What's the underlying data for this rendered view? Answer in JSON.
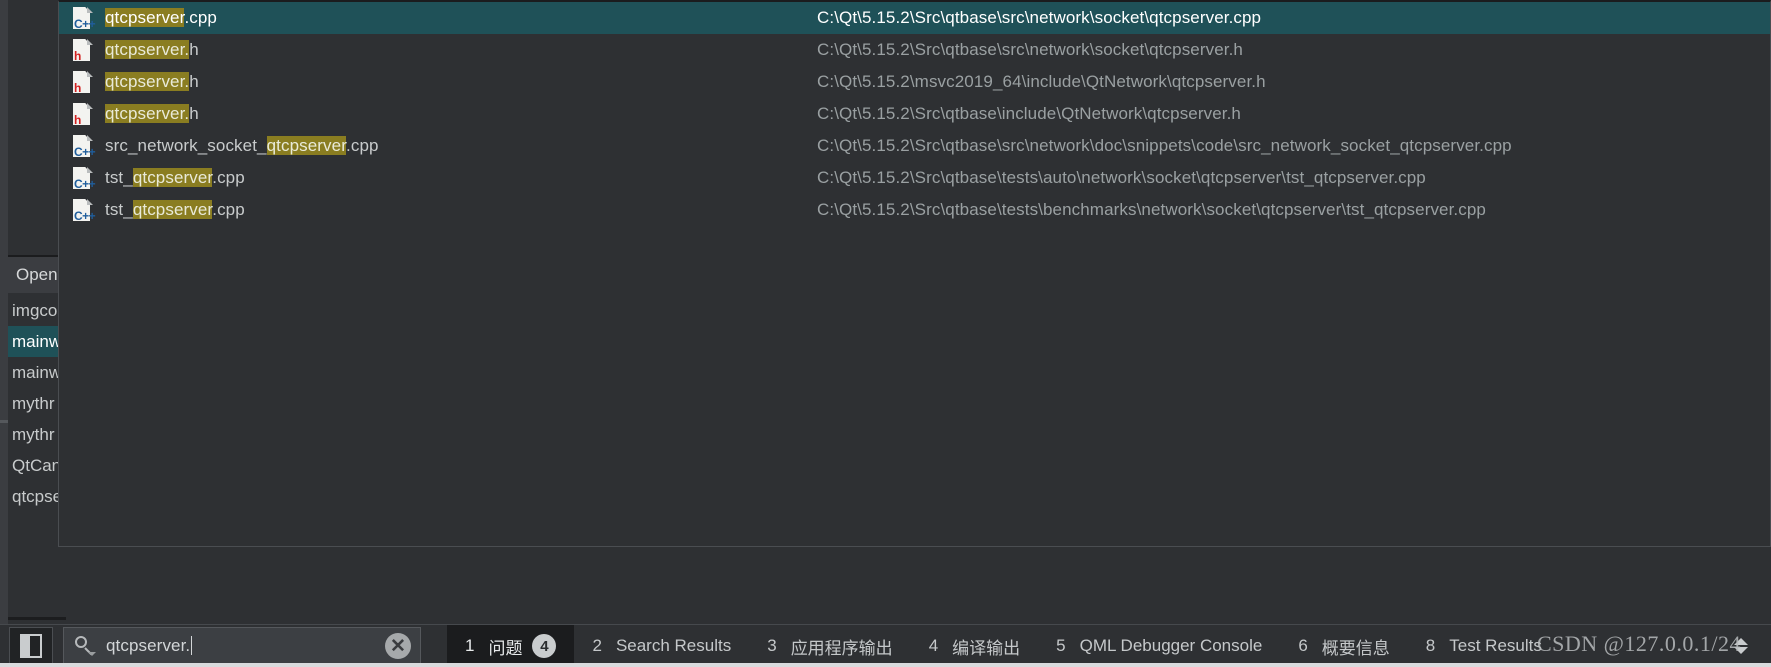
{
  "colors": {
    "background": "#2e3033",
    "selection_teal": "#1f5158",
    "match_highlight": "#8a7d21",
    "text_primary": "#c8cbcc",
    "text_muted": "#9aa0a2",
    "cpp_icon": "#1f5d9c",
    "h_icon": "#d32020"
  },
  "locator_popup": {
    "results": [
      {
        "icon": "cpp-file-icon",
        "icon_tag": "C++",
        "name_pre": "",
        "name_match": "qtcpserver",
        "name_post": ".cpp",
        "path": "C:\\Qt\\5.15.2\\Src\\qtbase\\src\\network\\socket\\qtcpserver.cpp",
        "selected": true
      },
      {
        "icon": "h-file-icon",
        "icon_tag": "h",
        "name_pre": "",
        "name_match": "qtcpserver.",
        "name_post": "h",
        "path": "C:\\Qt\\5.15.2\\Src\\qtbase\\src\\network\\socket\\qtcpserver.h",
        "selected": false
      },
      {
        "icon": "h-file-icon",
        "icon_tag": "h",
        "name_pre": "",
        "name_match": "qtcpserver.",
        "name_post": "h",
        "path": "C:\\Qt\\5.15.2\\msvc2019_64\\include\\QtNetwork\\qtcpserver.h",
        "selected": false
      },
      {
        "icon": "h-file-icon",
        "icon_tag": "h",
        "name_pre": "",
        "name_match": "qtcpserver.",
        "name_post": "h",
        "path": "C:\\Qt\\5.15.2\\Src\\qtbase\\include\\QtNetwork\\qtcpserver.h",
        "selected": false
      },
      {
        "icon": "cpp-file-icon",
        "icon_tag": "C++",
        "name_pre": "src_network_socket_",
        "name_match": "qtcpserver",
        "name_post": ".cpp",
        "path": "C:\\Qt\\5.15.2\\Src\\qtbase\\src\\network\\doc\\snippets\\code\\src_network_socket_qtcpserver.cpp",
        "selected": false
      },
      {
        "icon": "cpp-file-icon",
        "icon_tag": "C++",
        "name_pre": "tst_",
        "name_match": "qtcpserver",
        "name_post": ".cpp",
        "path": "C:\\Qt\\5.15.2\\Src\\qtbase\\tests\\auto\\network\\socket\\qtcpserver\\tst_qtcpserver.cpp",
        "selected": false
      },
      {
        "icon": "cpp-file-icon",
        "icon_tag": "C++",
        "name_pre": "tst_",
        "name_match": "qtcpserver",
        "name_post": ".cpp",
        "path": "C:\\Qt\\5.15.2\\Src\\qtbase\\tests\\benchmarks\\network\\socket\\qtcpserver\\tst_qtcpserver.cpp",
        "selected": false
      }
    ]
  },
  "mini_panel": {
    "header": "Open",
    "items": [
      {
        "label": "imgco",
        "selected": false
      },
      {
        "label": "mainw",
        "selected": true
      },
      {
        "label": "mainw",
        "selected": false
      },
      {
        "label": "mythr",
        "selected": false
      },
      {
        "label": "mythr",
        "selected": false
      },
      {
        "label": "QtCan",
        "selected": false
      },
      {
        "label": "qtcpse",
        "selected": false
      }
    ]
  },
  "bottom_bar": {
    "sidebar_toggle_icon": "sidebar-toggle-icon",
    "search": {
      "icon": "search-icon",
      "value": "qtcpserver.",
      "placeholder": "",
      "clear_icon": "clear-circle-icon"
    },
    "tabs": [
      {
        "num": "1",
        "label": "问题",
        "badge": "4",
        "active": true
      },
      {
        "num": "2",
        "label": "Search Results",
        "badge": "",
        "active": false
      },
      {
        "num": "3",
        "label": "应用程序输出",
        "badge": "",
        "active": false
      },
      {
        "num": "4",
        "label": "编译输出",
        "badge": "",
        "active": false
      },
      {
        "num": "5",
        "label": "QML Debugger Console",
        "badge": "",
        "active": false
      },
      {
        "num": "6",
        "label": "概要信息",
        "badge": "",
        "active": false
      },
      {
        "num": "8",
        "label": "Test Results",
        "badge": "",
        "active": false
      }
    ],
    "arrows_icon": "updown-arrows-icon"
  },
  "watermark": "CSDN @127.0.0.1/24"
}
